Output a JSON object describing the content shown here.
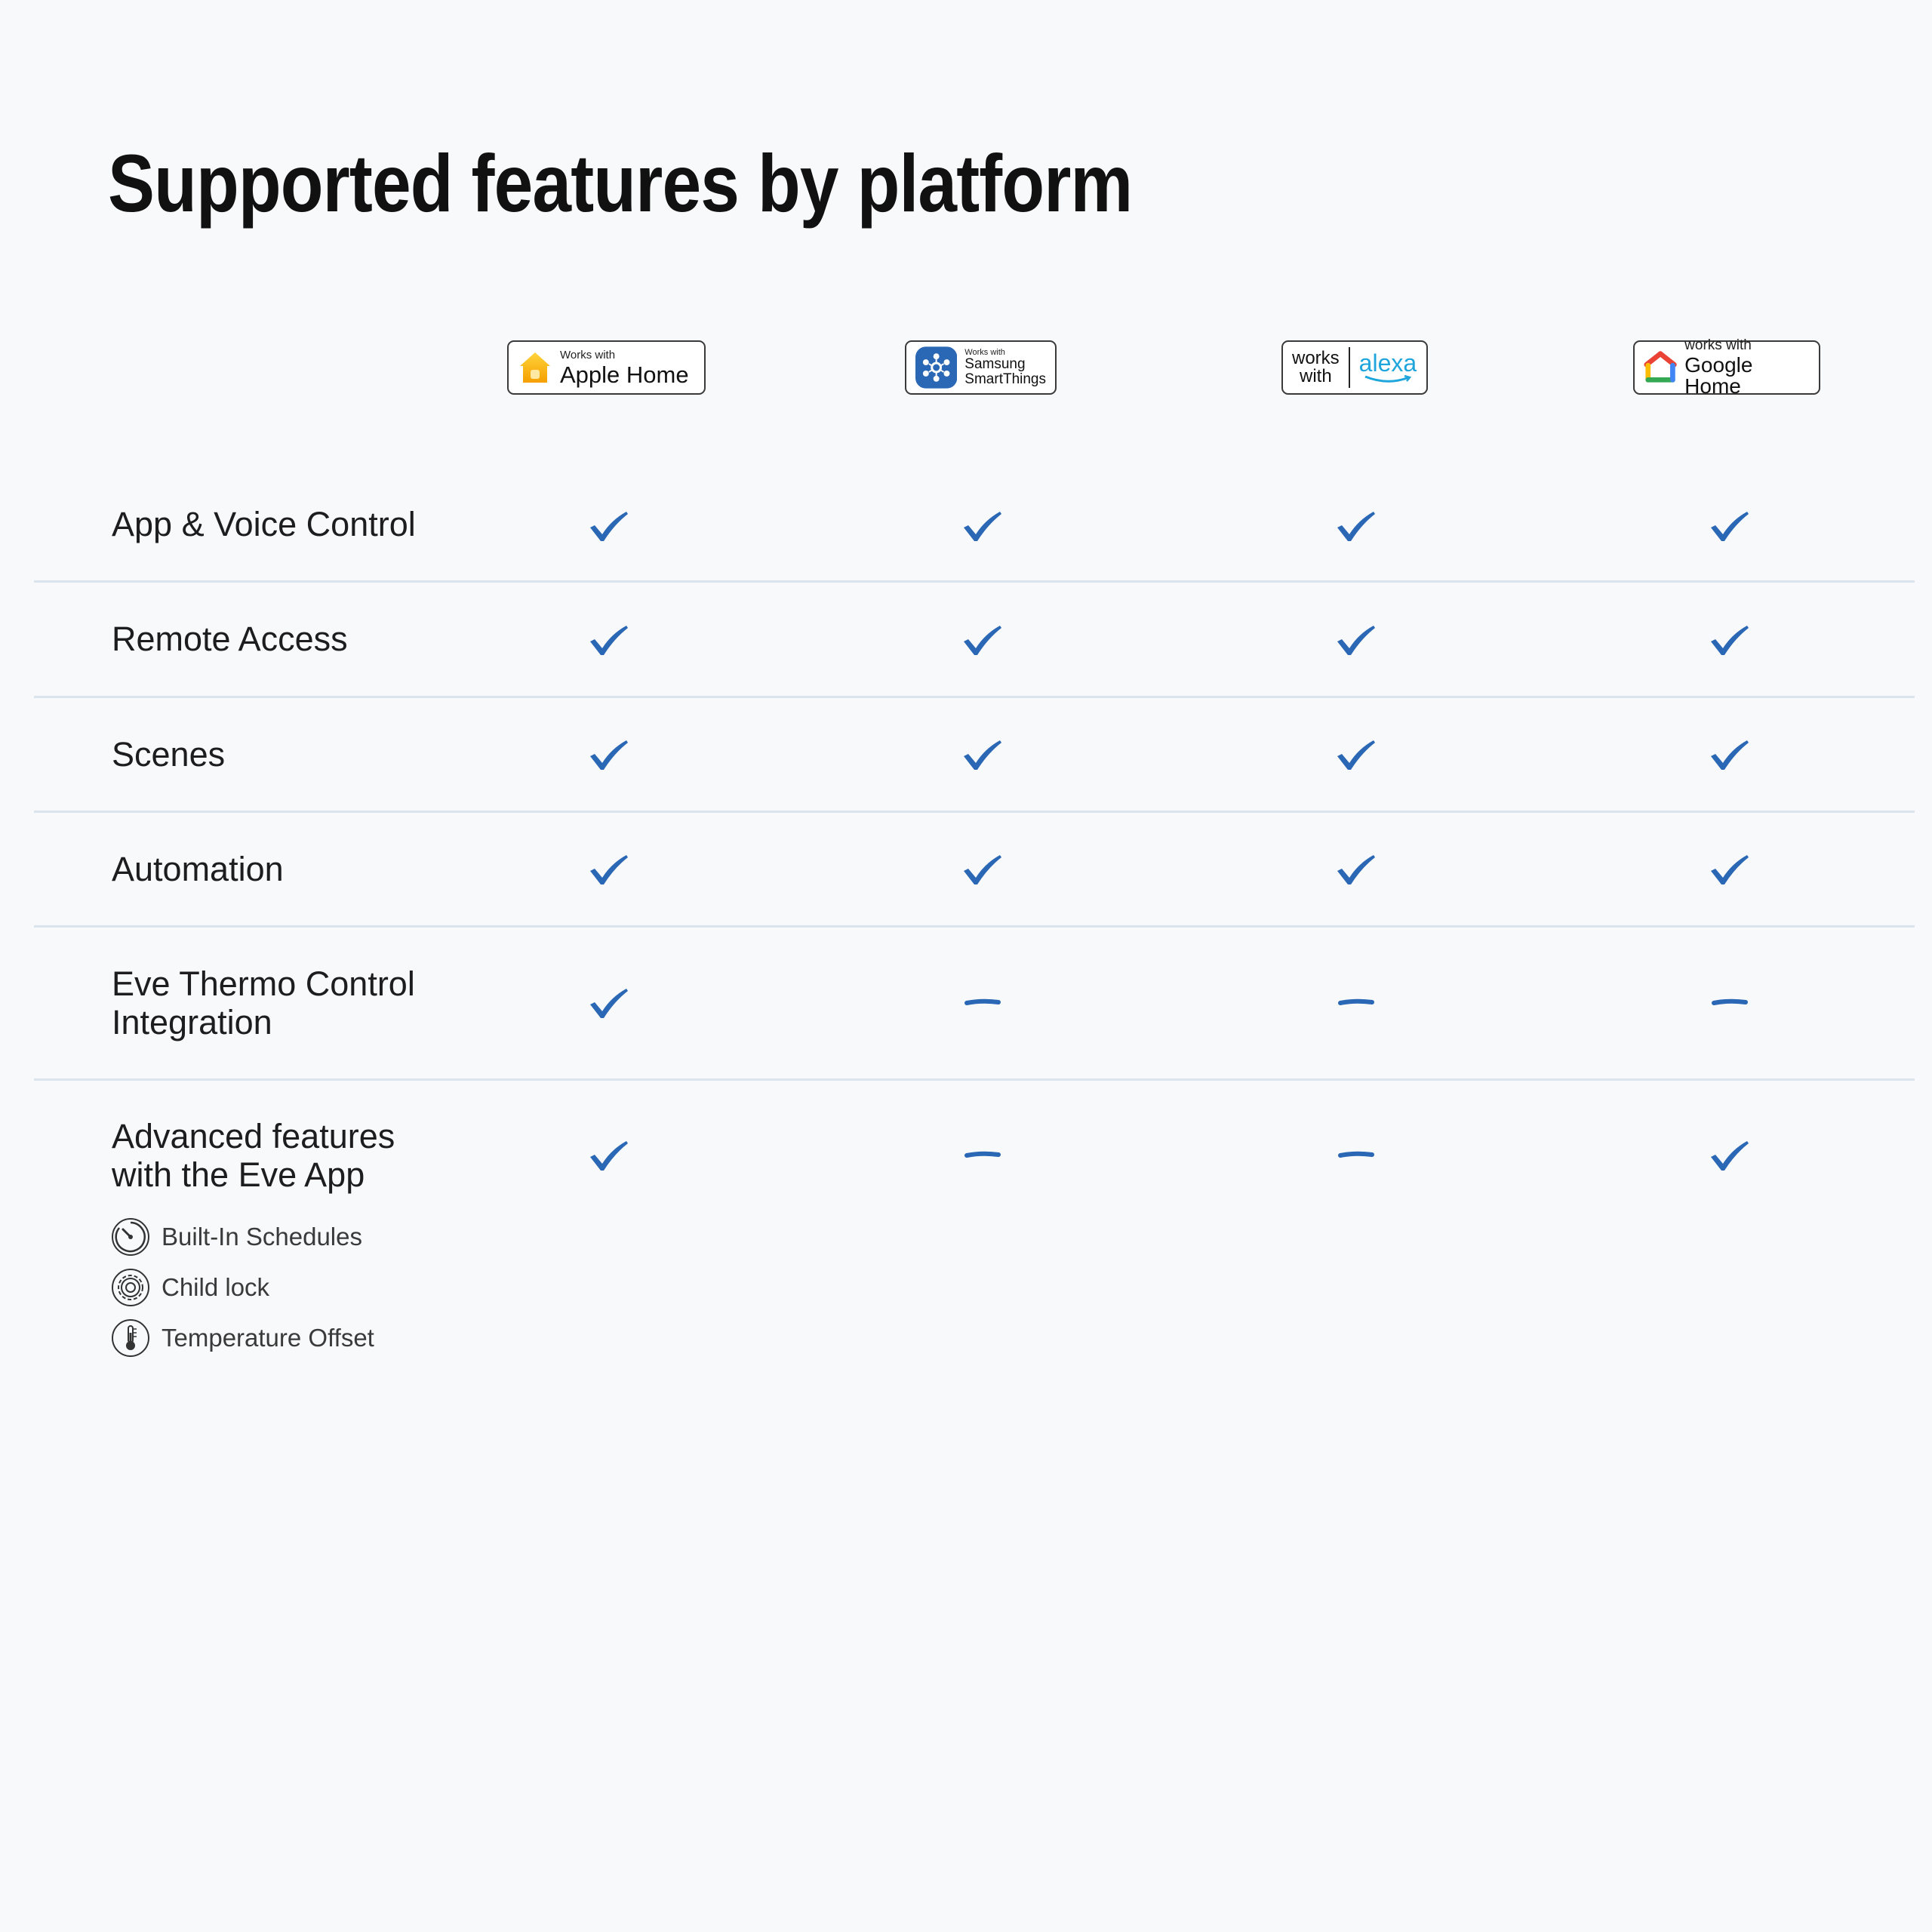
{
  "page": {
    "title": "Supported features by platform"
  },
  "platforms": [
    {
      "small": "Works with",
      "name": "Apple Home"
    },
    {
      "small": "Works with",
      "name_line1": "Samsung",
      "name_line2": "SmartThings"
    },
    {
      "works": "works",
      "with": "with",
      "name": "alexa"
    },
    {
      "small": "works with",
      "name": "Google Home"
    }
  ],
  "features": [
    {
      "label": "App & Voice Control",
      "support": [
        true,
        true,
        true,
        true
      ]
    },
    {
      "label": "Remote Access",
      "support": [
        true,
        true,
        true,
        true
      ]
    },
    {
      "label": "Scenes",
      "support": [
        true,
        true,
        true,
        true
      ]
    },
    {
      "label": "Automation",
      "support": [
        true,
        true,
        true,
        true
      ]
    },
    {
      "label_line1": "Eve Thermo Control",
      "label_line2": "Integration",
      "support": [
        true,
        false,
        false,
        false
      ]
    },
    {
      "label_line1": "Advanced features",
      "label_line2": "with the Eve App",
      "support": [
        true,
        false,
        false,
        true
      ]
    }
  ],
  "advanced_items": [
    {
      "label": "Built-In Schedules",
      "icon": "timer-icon"
    },
    {
      "label": "Child lock",
      "icon": "gear-lock-icon"
    },
    {
      "label": "Temperature Offset",
      "icon": "thermometer-icon"
    }
  ],
  "colors": {
    "mark": "#2a67b5",
    "divider": "#dbe4ec",
    "background": "#f8f9fa"
  }
}
